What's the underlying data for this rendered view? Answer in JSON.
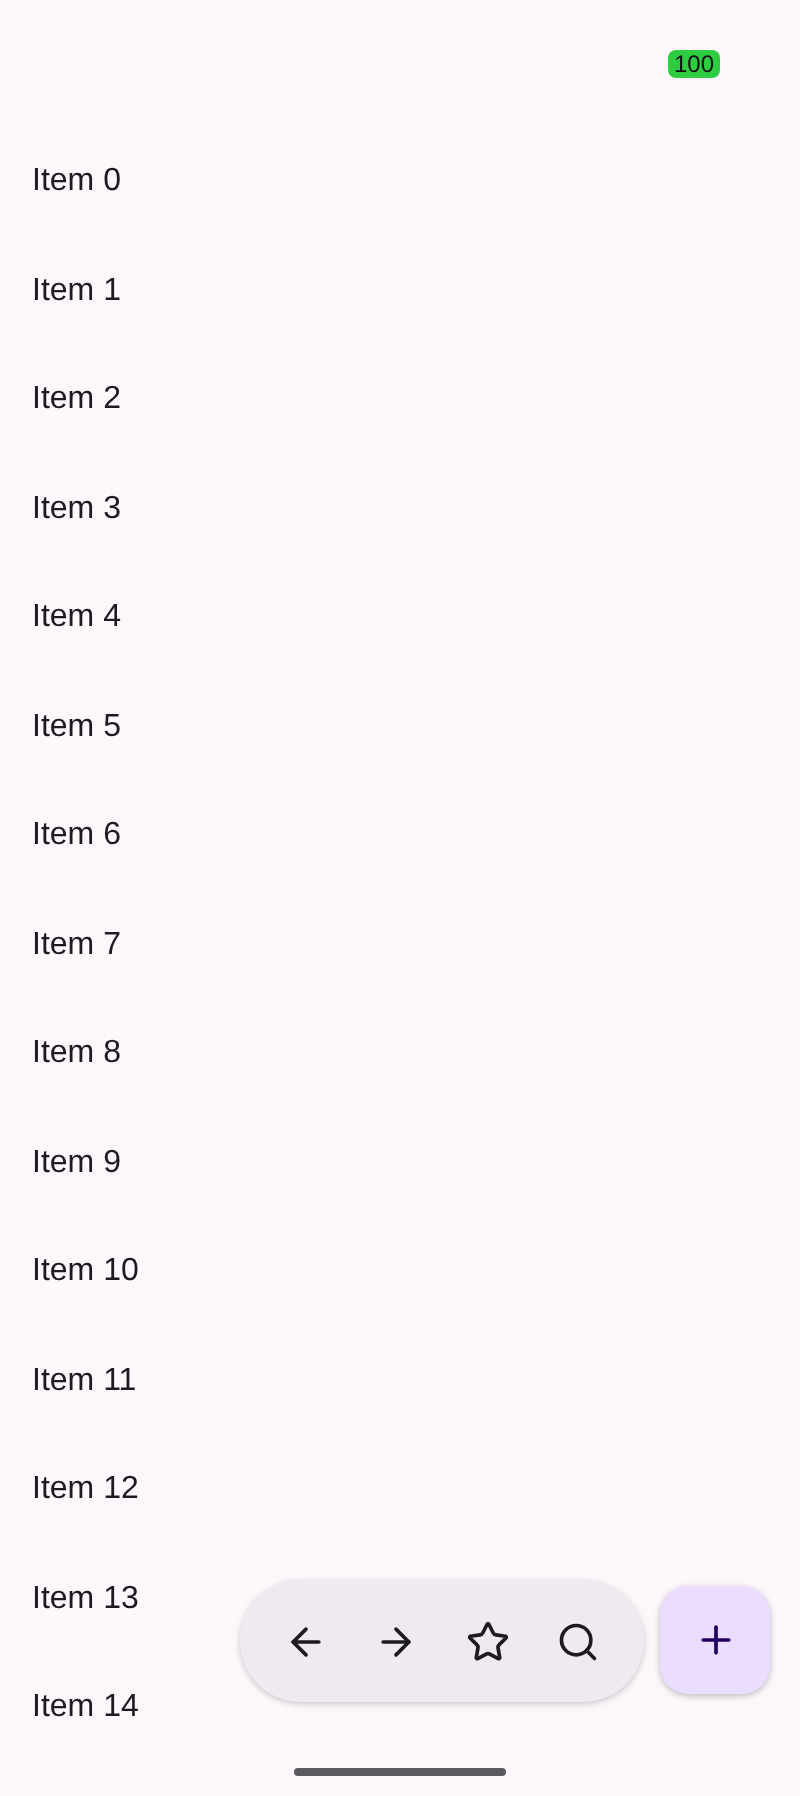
{
  "status_bar": {
    "battery": "100"
  },
  "items": [
    "Item 0",
    "Item 1",
    "Item 2",
    "Item 3",
    "Item 4",
    "Item 5",
    "Item 6",
    "Item 7",
    "Item 8",
    "Item 9",
    "Item 10",
    "Item 11",
    "Item 12",
    "Item 13",
    "Item 14"
  ],
  "toolbar": {
    "actions": [
      {
        "kind": "back"
      },
      {
        "kind": "forward"
      },
      {
        "kind": "star"
      },
      {
        "kind": "search"
      }
    ]
  },
  "fab": {
    "kind": "add"
  }
}
